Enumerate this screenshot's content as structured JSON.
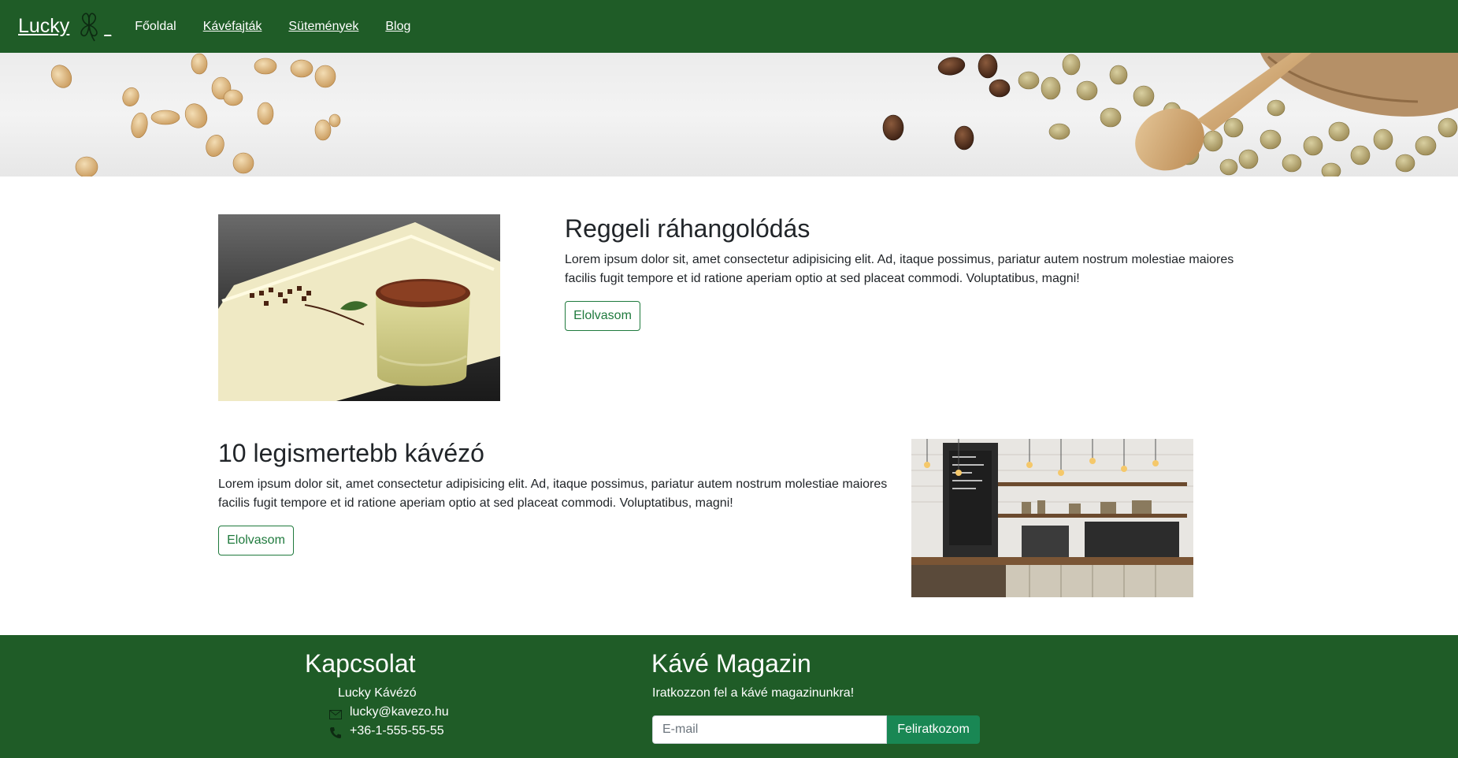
{
  "navbar": {
    "brand": "Lucky",
    "brand_suffix": "_",
    "links": [
      "Főoldal",
      "Kávéfajták",
      "Sütemények",
      "Blog"
    ]
  },
  "articles": [
    {
      "title": "Reggeli ráhangolódás",
      "text": "Lorem ipsum dolor sit, amet consectetur adipisicing elit. Ad, itaque possimus, pariatur autem nostrum molestiae maiores facilis fugit tempore et id ratione aperiam optio at sed placeat commodi. Voluptatibus, magni!",
      "button": "Elolvasom"
    },
    {
      "title": "10 legismertebb kávézó",
      "text": "Lorem ipsum dolor sit, amet consectetur adipisicing elit. Ad, itaque possimus, pariatur autem nostrum molestiae maiores facilis fugit tempore et id ratione aperiam optio at sed placeat commodi. Voluptatibus, magni!",
      "button": "Elolvasom"
    }
  ],
  "footer": {
    "contact": {
      "heading": "Kapcsolat",
      "name": "Lucky Kávézó",
      "email": "lucky@kavezo.hu",
      "phone": "+36-1-555-55-55"
    },
    "magazine": {
      "heading": "Kávé Magazin",
      "text": "Iratkozzon fel a kávé magazinunkra!",
      "email_placeholder": "E-mail",
      "button": "Feliratkozom"
    }
  },
  "colors": {
    "brand_green": "#1f5c27",
    "button_green": "#198754",
    "outline_green": "#1f7a3d"
  },
  "icons": [
    "clover-icon",
    "envelope-icon",
    "phone-icon"
  ]
}
